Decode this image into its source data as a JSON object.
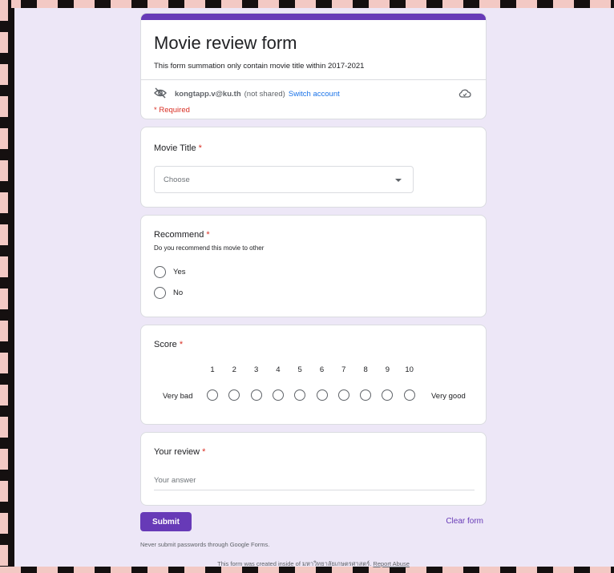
{
  "header": {
    "title": "Movie review form",
    "description": "This form summation only contain movie title within 2017-2021",
    "account_email": "kongtapp.v@ku.th",
    "not_shared": "(not shared)",
    "switch_account": "Switch account",
    "required_note": "* Required",
    "accent_color": "#673ab7"
  },
  "questions": {
    "title": {
      "label": "Movie Title",
      "required_mark": "*",
      "dropdown_value": "Choose"
    },
    "recommend": {
      "label": "Recommend",
      "required_mark": "*",
      "help": "Do you recommend this movie to other",
      "options": [
        "Yes",
        "No"
      ]
    },
    "score": {
      "label": "Score",
      "required_mark": "*",
      "scale": [
        "1",
        "2",
        "3",
        "4",
        "5",
        "6",
        "7",
        "8",
        "9",
        "10"
      ],
      "low_label": "Very bad",
      "high_label": "Very good"
    },
    "review": {
      "label": "Your review",
      "required_mark": "*",
      "placeholder": "Your answer"
    }
  },
  "actions": {
    "submit": "Submit",
    "clear": "Clear form"
  },
  "footer": {
    "warning": "Never submit passwords through Google Forms.",
    "created_prefix": "This form was created inside of มหาวิทยาลัยเกษตรศาสตร์.",
    "report": "Report Abuse"
  },
  "icons": {
    "visibility": "eye-off-icon",
    "cloud": "cloud-saved-icon"
  }
}
